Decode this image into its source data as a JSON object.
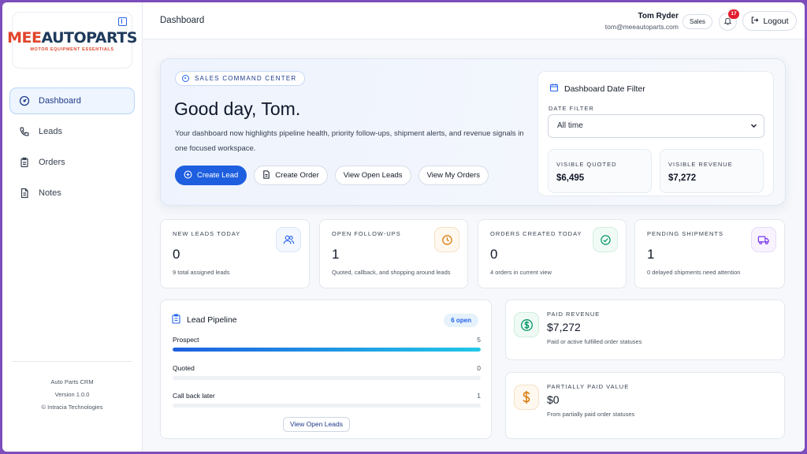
{
  "brand": {
    "logo_main_a": "MEE",
    "logo_main_b": "AUTOPARTS",
    "logo_sub": "MOTOR EQUIPMENT ESSENTIALS",
    "colors": {
      "accent": "#1e5fe0",
      "logo_red": "#e0462c",
      "logo_navy": "#1f3a5c"
    }
  },
  "sidebar": {
    "items": [
      {
        "label": "Dashboard",
        "icon": "gauge-icon",
        "active": true
      },
      {
        "label": "Leads",
        "icon": "phone-icon",
        "active": false
      },
      {
        "label": "Orders",
        "icon": "clipboard-icon",
        "active": false
      },
      {
        "label": "Notes",
        "icon": "note-icon",
        "active": false
      }
    ],
    "footer": {
      "app_name": "Auto Parts CRM",
      "version": "Version 1.0.0",
      "copyright": "© Intracia Technologies"
    }
  },
  "header": {
    "breadcrumb": "Dashboard",
    "user_name": "Tom Ryder",
    "user_email": "tom@meeautoparts.com",
    "role": "Sales",
    "notification_count": "17",
    "logout_label": "Logout"
  },
  "hero": {
    "tag": "SALES COMMAND CENTER",
    "title": "Good day, Tom.",
    "description": "Your dashboard now highlights pipeline health, priority follow-ups, shipment alerts, and revenue signals in one focused workspace.",
    "actions": {
      "create_lead": "Create Lead",
      "create_order": "Create Order",
      "view_open_leads": "View Open Leads",
      "view_my_orders": "View My Orders"
    },
    "filter": {
      "title": "Dashboard Date Filter",
      "label": "DATE FILTER",
      "selected": "All time",
      "visible_quoted_label": "VISIBLE QUOTED",
      "visible_quoted_value": "$6,495",
      "visible_revenue_label": "VISIBLE REVENUE",
      "visible_revenue_value": "$7,272"
    }
  },
  "kpis": [
    {
      "label": "NEW LEADS TODAY",
      "value": "0",
      "sub": "9 total assigned leads",
      "icon": "users-icon",
      "color": "#2563eb"
    },
    {
      "label": "OPEN FOLLOW-UPS",
      "value": "1",
      "sub": "Quoted, callback, and shopping around leads",
      "icon": "clock-icon",
      "color": "#d97706"
    },
    {
      "label": "ORDERS CREATED TODAY",
      "value": "0",
      "sub": "4 orders in current view",
      "icon": "check-circle-icon",
      "color": "#059669"
    },
    {
      "label": "PENDING SHIPMENTS",
      "value": "1",
      "sub": "0 delayed shipments need attention",
      "icon": "truck-icon",
      "color": "#7c3aed"
    }
  ],
  "pipeline": {
    "title": "Lead Pipeline",
    "badge": "6 open",
    "rows": [
      {
        "name": "Prospect",
        "count": "5",
        "fill": 1.0
      },
      {
        "name": "Quoted",
        "count": "0",
        "fill": 0
      },
      {
        "name": "Call back later",
        "count": "1",
        "fill": 0
      }
    ],
    "button": "View Open Leads"
  },
  "revenue": {
    "paid": {
      "label": "PAID REVENUE",
      "value": "$7,272",
      "sub": "Paid or active fulfilled order statuses",
      "icon": "dollar-circle-icon"
    },
    "partial": {
      "label": "PARTIALLY PAID VALUE",
      "value": "$0",
      "sub": "From partially paid order statuses",
      "icon": "dollar-sign-icon"
    }
  }
}
